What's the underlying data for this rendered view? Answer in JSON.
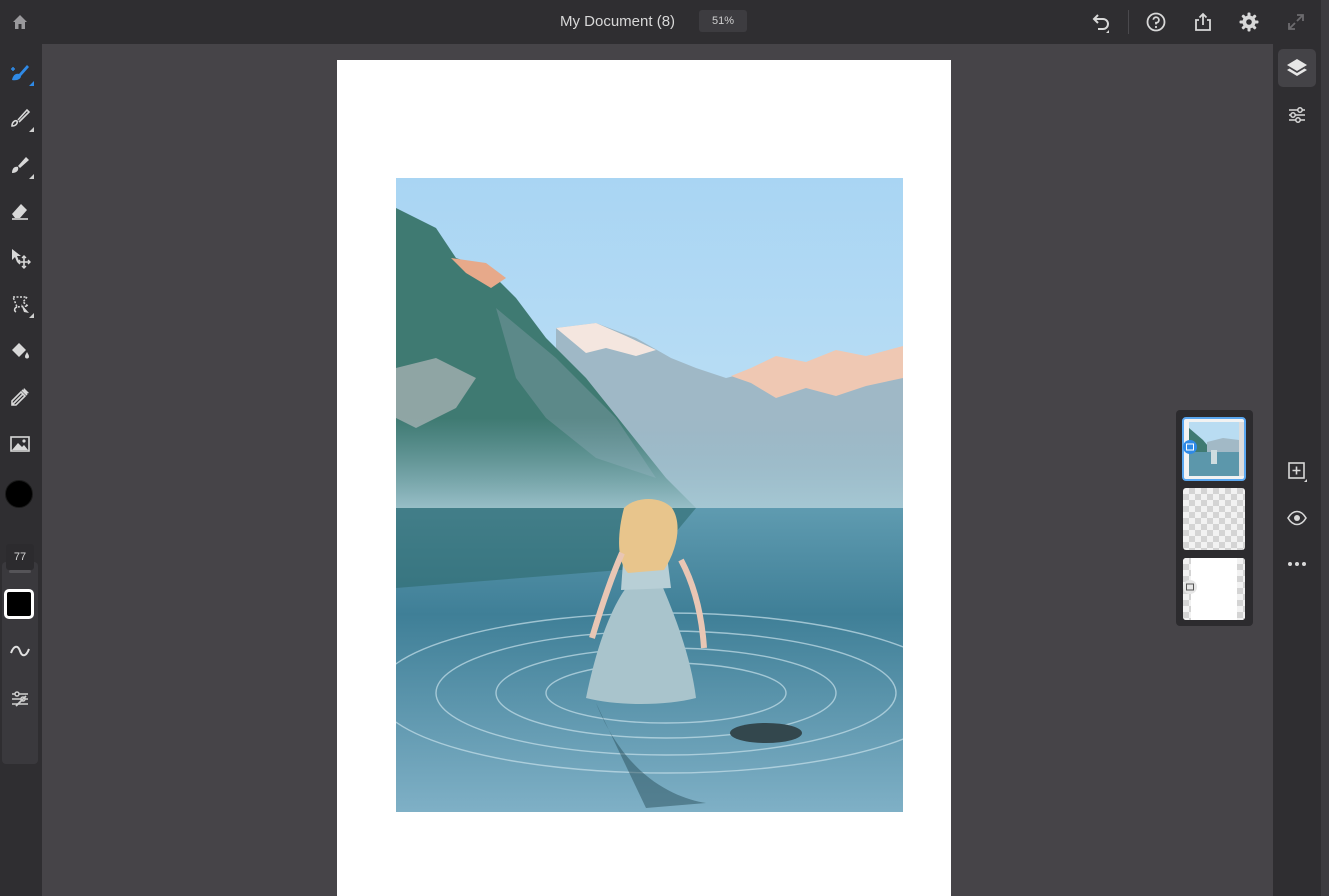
{
  "header": {
    "document_title": "My Document (8)",
    "zoom_level": "51%",
    "icons": [
      "home-icon",
      "undo-icon",
      "help-icon",
      "share-icon",
      "settings-icon",
      "fullscreen-icon"
    ]
  },
  "toolbar": {
    "brush_size": "77",
    "active_tool": "selection-brush",
    "tools": [
      "quick-selection-icon",
      "brush-icon",
      "brush-variant-icon",
      "eraser-icon",
      "move-transform-icon",
      "lasso-icon",
      "fill-bucket-icon",
      "eyedropper-icon",
      "place-image-icon"
    ],
    "primary_color": "#000000"
  },
  "layers": {
    "count": 3,
    "selected_index": 0
  },
  "colors": {
    "accent": "#2f8ae6",
    "background": "#464448",
    "panel": "#2f2e31"
  }
}
